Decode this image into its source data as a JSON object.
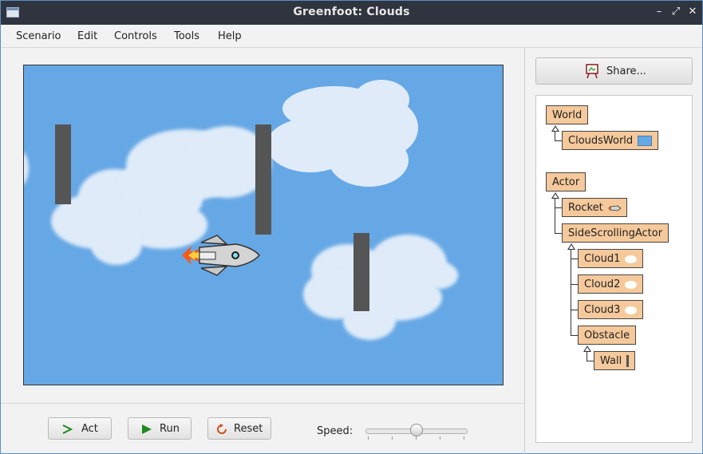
{
  "window": {
    "title": "Greenfoot: Clouds"
  },
  "menu": [
    "Scenario",
    "Edit",
    "Controls",
    "Tools",
    "Help"
  ],
  "controls": {
    "act_label": "Act",
    "run_label": "Run",
    "reset_label": "Reset",
    "speed_label": "Speed:",
    "speed_value": 0.5
  },
  "share": {
    "label": "Share..."
  },
  "class_tree": {
    "world": {
      "label": "World",
      "children": [
        {
          "label": "CloudsWorld"
        }
      ]
    },
    "actor": {
      "label": "Actor",
      "children": [
        {
          "label": "Rocket"
        },
        {
          "label": "SideScrollingActor",
          "children": [
            {
              "label": "Cloud1"
            },
            {
              "label": "Cloud2"
            },
            {
              "label": "Cloud3"
            },
            {
              "label": "Obstacle",
              "children": [
                {
                  "label": "Wall"
                }
              ]
            }
          ]
        }
      ]
    }
  },
  "colors": {
    "sky": "#66a8e5",
    "class_box": "#f5c99b",
    "titlebar": "#2f343f"
  }
}
